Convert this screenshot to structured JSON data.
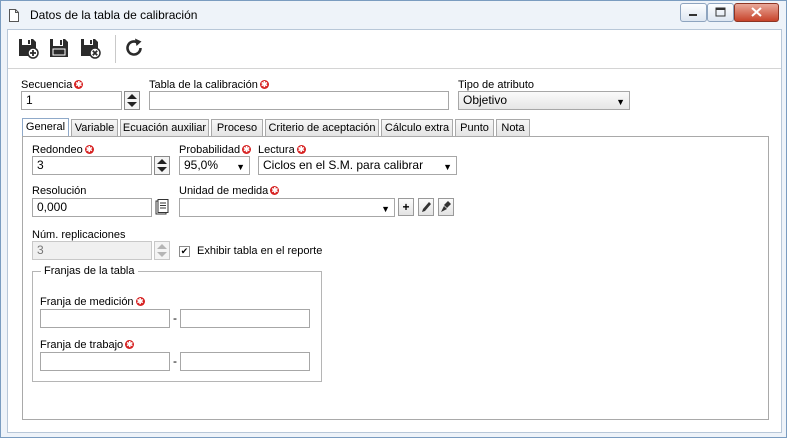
{
  "window": {
    "title": "Datos de la tabla de calibración"
  },
  "toolbar": {
    "save_new_icon": "save-new-icon",
    "save_icon": "save-icon",
    "save_close_icon": "save-close-icon",
    "refresh_icon": "refresh-icon"
  },
  "header": {
    "sequence_label": "Secuencia",
    "sequence_value": "1",
    "table_label": "Tabla de la calibración",
    "table_value": "",
    "attr_type_label": "Tipo de atributo",
    "attr_type_value": "Objetivo"
  },
  "tabs": [
    {
      "label": "General"
    },
    {
      "label": "Variable"
    },
    {
      "label": "Ecuación auxiliar"
    },
    {
      "label": "Proceso"
    },
    {
      "label": "Criterio de aceptación"
    },
    {
      "label": "Cálculo extra"
    },
    {
      "label": "Punto"
    },
    {
      "label": "Nota"
    }
  ],
  "general": {
    "rounding_label": "Redondeo",
    "rounding_value": "3",
    "probability_label": "Probabilidad",
    "probability_value": "95,0%",
    "reading_label": "Lectura",
    "reading_value": "Ciclos en el S.M. para calibrar",
    "resolution_label": "Resolución",
    "resolution_value": "0,000",
    "unit_label": "Unidad de medida",
    "unit_value": "",
    "replications_label": "Núm. replicaciones",
    "replications_value": "3",
    "show_table_label": "Exhibir tabla en el reporte",
    "show_table_checked": true,
    "ranges_legend": "Franjas de la tabla",
    "measure_range_label": "Franja de medición",
    "work_range_label": "Franja de trabajo",
    "dash": "-"
  },
  "colors": {
    "required": "#d62020",
    "window_border": "#7a9cc0",
    "close_button": "#c7432a"
  }
}
